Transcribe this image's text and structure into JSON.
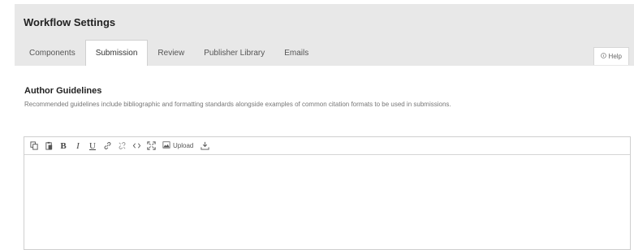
{
  "header": {
    "title": "Workflow Settings",
    "tabs": [
      {
        "label": "Components",
        "active": false
      },
      {
        "label": "Submission",
        "active": true
      },
      {
        "label": "Review",
        "active": false
      },
      {
        "label": "Publisher Library",
        "active": false
      },
      {
        "label": "Emails",
        "active": false
      }
    ],
    "help": {
      "icon": "info-icon",
      "label": "Help"
    }
  },
  "section": {
    "title": "Author Guidelines",
    "description": "Recommended guidelines include bibliographic and formatting standards alongside examples of common citation formats to be used in submissions."
  },
  "editor": {
    "toolbar": {
      "copy_icon": "copy-icon",
      "paste_icon": "paste-icon",
      "bold": "B",
      "italic": "I",
      "underline": "U",
      "link_icon": "link-icon",
      "unlink_icon": "unlink-icon",
      "code_icon": "code-icon",
      "fullscreen_icon": "fullscreen-icon",
      "upload_label": "Upload",
      "download_icon": "download-icon"
    },
    "content": ""
  },
  "colors": {
    "header_bg": "#e8e8e8",
    "tab_active_bg": "#ffffff",
    "border": "#cfcfcf"
  }
}
